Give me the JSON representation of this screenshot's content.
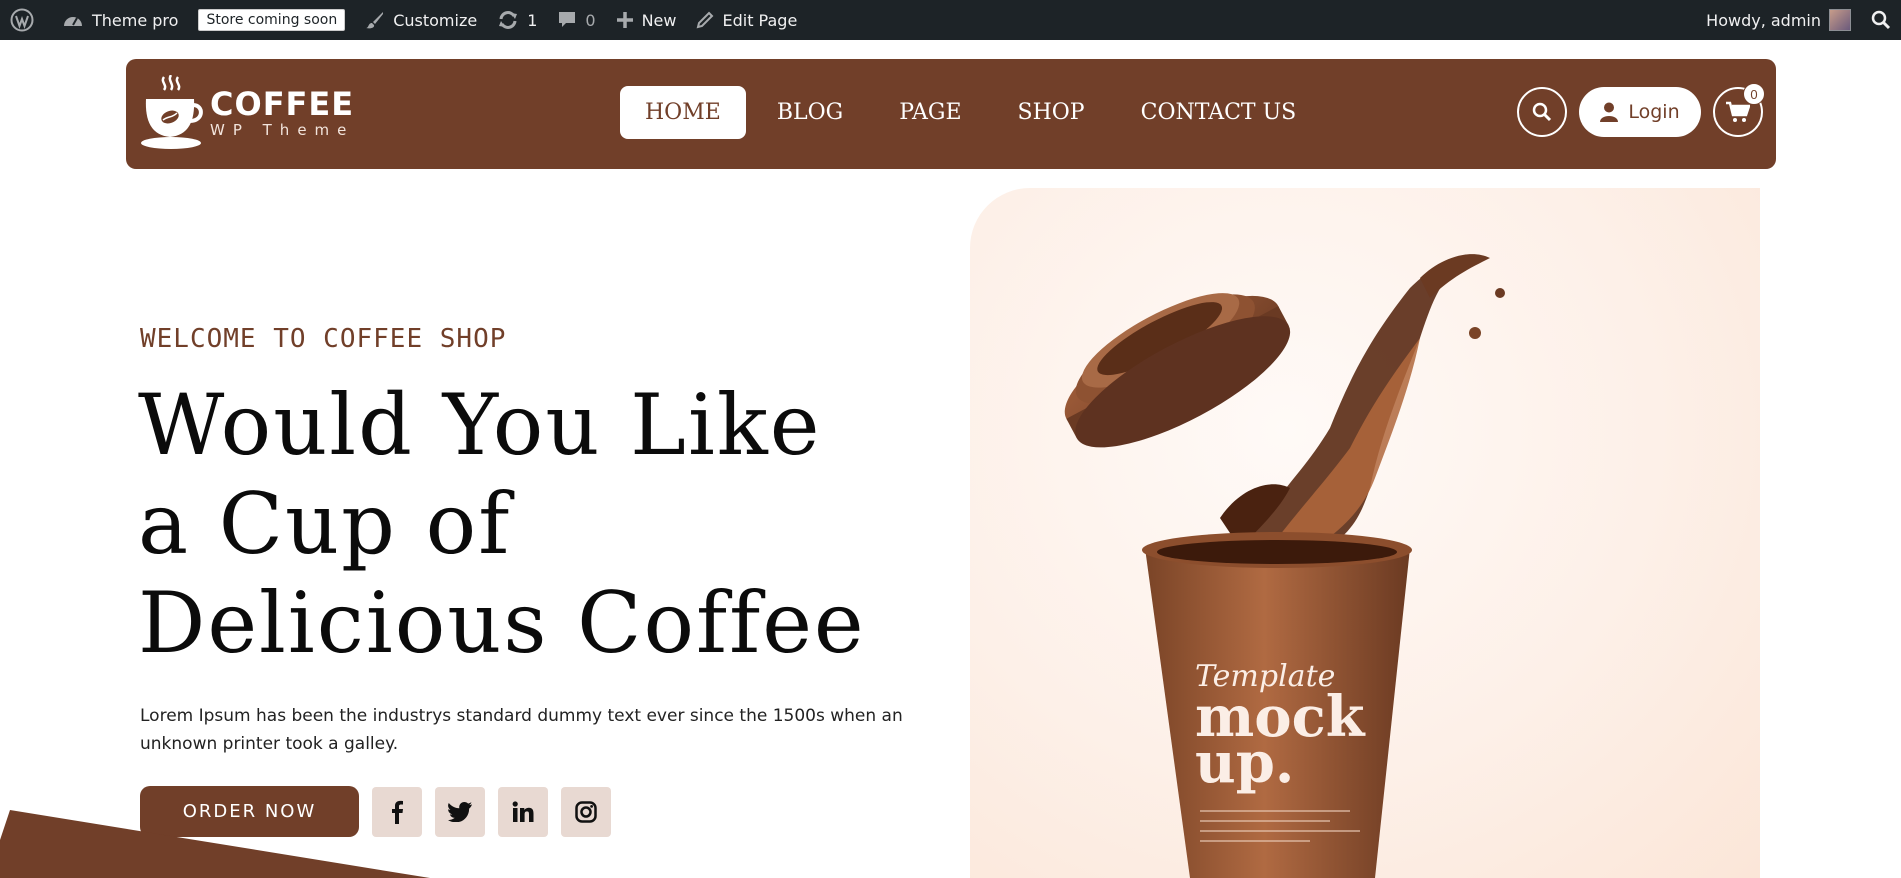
{
  "adminbar": {
    "site_name": "Theme pro",
    "store_badge": "Store coming soon",
    "customize": "Customize",
    "updates_count": "1",
    "comments_count": "0",
    "new": "New",
    "edit_page": "Edit Page",
    "howdy": "Howdy, admin"
  },
  "header": {
    "logo_title": "COFFEE",
    "logo_sub": "WP Theme",
    "nav": [
      "HOME",
      "BLOG",
      "PAGE",
      "SHOP",
      "CONTACT US"
    ],
    "active_nav": "HOME",
    "login": "Login",
    "cart_count": "0"
  },
  "hero": {
    "welcome": "WELCOME TO COFFEE SHOP",
    "title": "Would You Like a Cup of Delicious Coffee",
    "description": "Lorem Ipsum has been the industrys standard dummy text ever since the 1500s when an unknown printer took a galley.",
    "order_button": "ORDER NOW",
    "cup_script": "Template",
    "cup_word1": "mock",
    "cup_word2": "up."
  },
  "colors": {
    "brand_brown": "#713f29",
    "admin_bar": "#1d2327",
    "social_bg": "#e8d9d2"
  },
  "icons": [
    "wordpress-logo-icon",
    "dashboard-icon",
    "brush-icon",
    "refresh-icon",
    "comment-icon",
    "plus-icon",
    "pencil-icon",
    "search-icon",
    "user-icon",
    "cart-icon",
    "facebook-icon",
    "twitter-icon",
    "linkedin-icon",
    "instagram-icon"
  ]
}
